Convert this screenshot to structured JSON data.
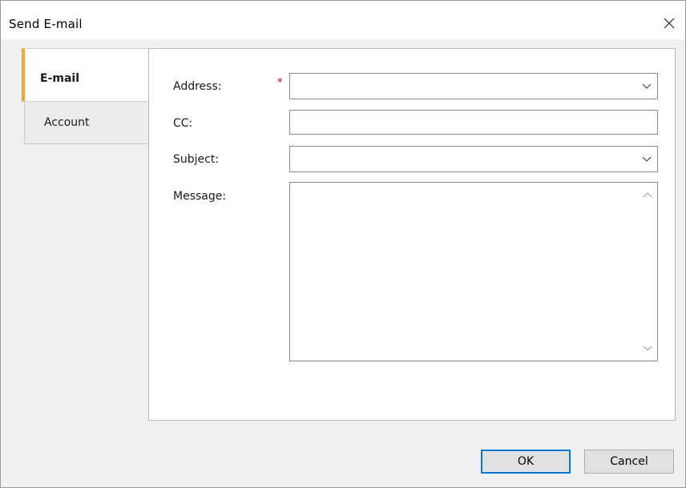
{
  "window": {
    "title": "Send E-mail"
  },
  "tabs": [
    {
      "label": "E-mail",
      "active": true
    },
    {
      "label": "Account",
      "active": false
    }
  ],
  "form": {
    "address": {
      "label": "Address:",
      "required_mark": "*",
      "value": ""
    },
    "cc": {
      "label": "CC:",
      "value": ""
    },
    "subject": {
      "label": "Subject:",
      "value": ""
    },
    "message": {
      "label": "Message:",
      "value": ""
    }
  },
  "buttons": {
    "ok": "OK",
    "cancel": "Cancel"
  },
  "colors": {
    "active_tab_accent": "#f5a623",
    "required": "#d00000",
    "default_button_border": "#0078d7"
  }
}
